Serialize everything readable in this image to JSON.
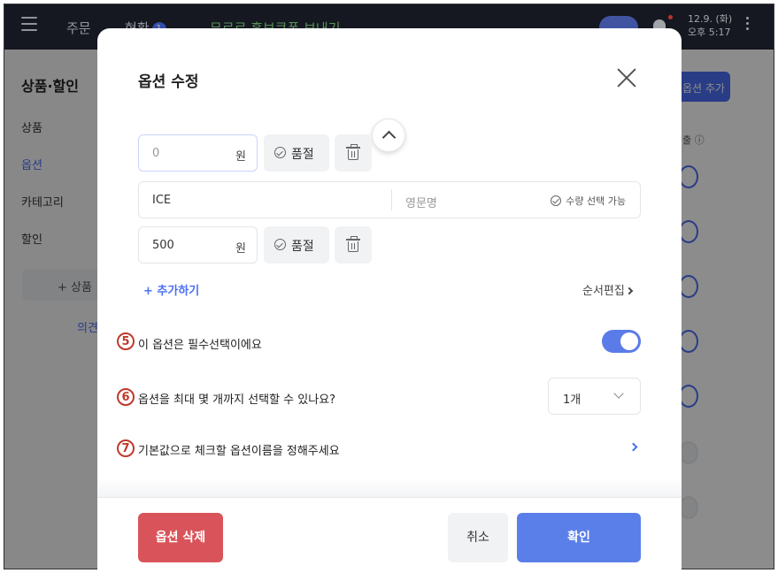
{
  "topbar": {
    "nav_order": "주문",
    "nav_status": "현황",
    "status_badge": "1",
    "promo_text": "무료로 홍보쿠폰 보내기",
    "date_line1": "12.9. (화)",
    "date_line2": "오후 5:17"
  },
  "sidebar": {
    "title": "상품·할인",
    "items": [
      {
        "label": "상품"
      },
      {
        "label": "옵션"
      },
      {
        "label": "카테고리"
      },
      {
        "label": "할인"
      }
    ],
    "add_button": "+ 상품 ",
    "feedback": "의견"
  },
  "right_panel": {
    "add_button": "옵션 추가",
    "column_header": "출 ⓘ"
  },
  "modal": {
    "title": "옵션 수정",
    "option_rows": [
      {
        "price": "0",
        "price_is_placeholder": true,
        "unit": "원",
        "soldout_label": "품절"
      },
      {
        "price": "500",
        "price_is_placeholder": false,
        "unit": "원",
        "soldout_label": "품절"
      }
    ],
    "name_row": {
      "name_ko": "ICE",
      "name_en_placeholder": "영문명",
      "qty_toggle": "수량 선택 가능"
    },
    "add_link": "+ 추가하기",
    "reorder_link": "순서편집",
    "settings": [
      {
        "number": "5",
        "label": "이 옵션은 필수선택이에요",
        "toggle_on": true
      },
      {
        "number": "6",
        "label": "옵션을 최대 몇 개까지 선택할 수 있나요?",
        "select_value": "1개"
      },
      {
        "number": "7",
        "label": "기본값으로 체크할 옵션이름을 정해주세요"
      }
    ],
    "footer": {
      "delete_label": "옵션 삭제",
      "cancel_label": "취소",
      "confirm_label": "확인"
    }
  },
  "colors": {
    "accent": "#4b6ff5",
    "danger": "#d9545a",
    "annotation": "#c0392b"
  }
}
